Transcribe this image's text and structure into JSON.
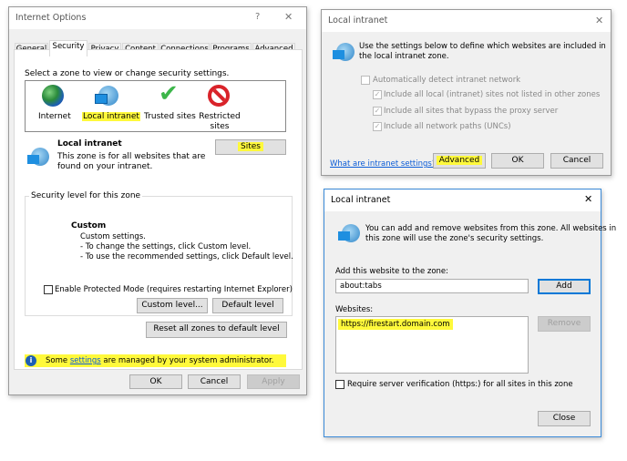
{
  "internet_options": {
    "title": "Internet Options",
    "help": "?",
    "close": "✕",
    "tabs": [
      "General",
      "Security",
      "Privacy",
      "Content",
      "Connections",
      "Programs",
      "Advanced"
    ],
    "selected_tab": "Security",
    "zone_prompt": "Select a zone to view or change security settings.",
    "zones": [
      {
        "label": "Internet",
        "icon": "globe-icon"
      },
      {
        "label": "Local intranet",
        "icon": "intranet-icon",
        "selected": true
      },
      {
        "label": "Trusted sites",
        "icon": "checkmark-icon"
      },
      {
        "label": "Restricted sites",
        "icon": "restricted-icon"
      }
    ],
    "zone_title": "Local intranet",
    "zone_desc_1": "This zone is for all websites that are",
    "zone_desc_2": "found on your intranet.",
    "sites_button": "Sites",
    "security_group": "Security level for this zone",
    "level_name": "Custom",
    "level_lines": [
      "Custom settings.",
      "- To change the settings, click Custom level.",
      "- To use the recommended settings, click Default level."
    ],
    "protected_mode": "Enable Protected Mode (requires restarting Internet Explorer)",
    "protected_mode_checked": false,
    "custom_level": "Custom level...",
    "default_level": "Default level",
    "reset_all": "Reset all zones to default level",
    "info_pre": "Some ",
    "info_link": "settings",
    "info_post": " are managed by your system administrator.",
    "ok": "OK",
    "cancel": "Cancel",
    "apply": "Apply"
  },
  "intranet_dialog": {
    "title": "Local intranet",
    "close": "✕",
    "desc_1": "Use the settings below to define which websites are included in",
    "desc_2": "the local intranet zone.",
    "auto_detect": "Automatically detect intranet network",
    "auto_detect_checked": false,
    "options": [
      {
        "label": "Include all local (intranet) sites not listed in other zones",
        "checked": true
      },
      {
        "label": "Include all sites that bypass the proxy server",
        "checked": true
      },
      {
        "label": "Include all network paths (UNCs)",
        "checked": true
      }
    ],
    "help_link": "What are intranet settings?",
    "advanced": "Advanced",
    "ok": "OK",
    "cancel": "Cancel"
  },
  "sites_dialog": {
    "title": "Local intranet",
    "close": "✕",
    "desc_1": "You can add and remove websites from this zone. All websites in",
    "desc_2": "this zone will use the zone's security settings.",
    "add_label": "Add this website to the zone:",
    "add_value": "about:tabs",
    "add_button": "Add",
    "websites_label": "Websites:",
    "websites": [
      "https://firestart.domain.com"
    ],
    "remove_button": "Remove",
    "require_https": "Require server verification (https:) for all sites in this zone",
    "require_https_checked": false,
    "close_button": "Close"
  },
  "colors": {
    "highlight": "#fff93b",
    "accent": "#0078d7",
    "link": "#0b5cd7"
  }
}
